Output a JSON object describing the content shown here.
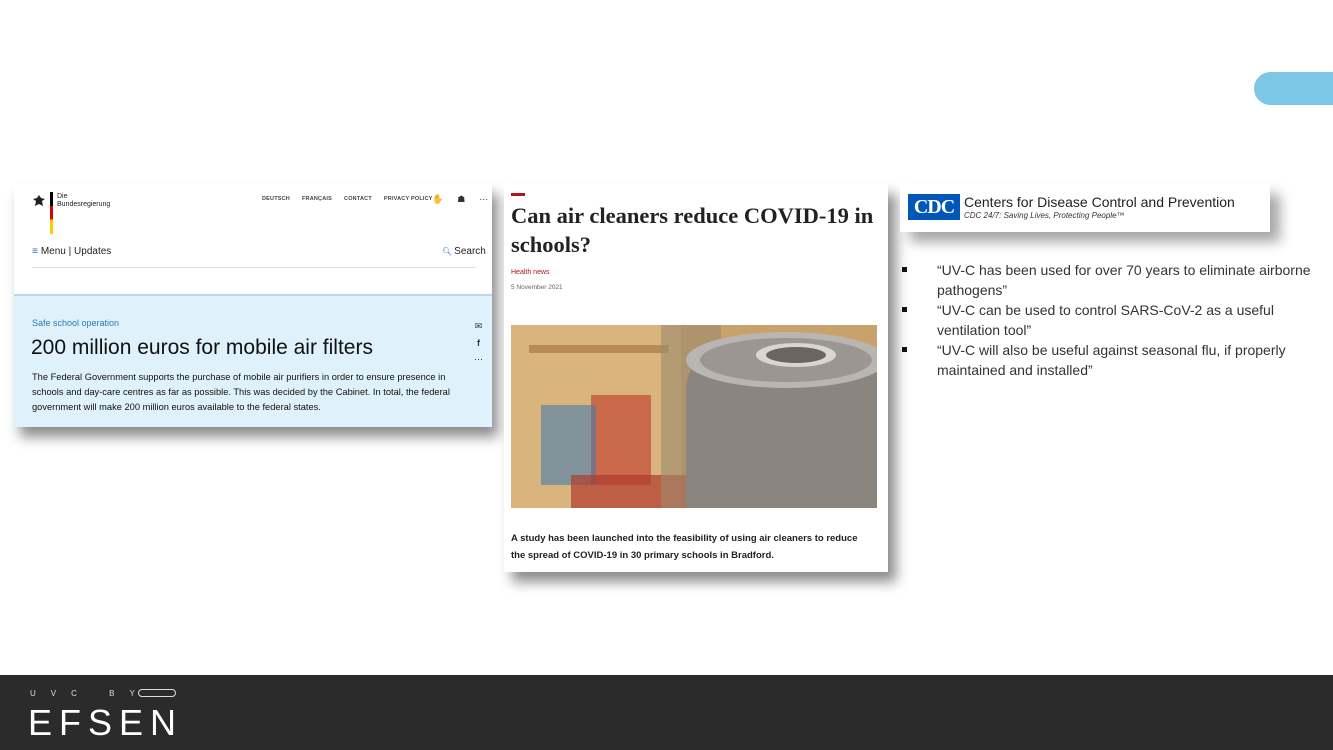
{
  "card_bund": {
    "brand": "Die Bundesregierung",
    "nav": [
      "DEUTSCH",
      "FRANÇAIS",
      "CONTACT",
      "PRIVACY POLICY"
    ],
    "menu_label": "Menu",
    "updates_label": "Updates",
    "search_label": "Search",
    "kicker": "Safe school operation",
    "headline": "200 million euros for mobile air filters",
    "body": "The Federal Government supports the purchase of mobile air purifiers in order to ensure presence in schools and day-care centres as far as possible. This was decided by the Cabinet. In total, the federal government will make 200 million euros available to the federal states."
  },
  "card_news": {
    "headline": "Can air cleaners reduce COVID-19 in schools?",
    "category": "Health news",
    "date": "5 November 2021",
    "lede": "A study has been launched into the feasibility of using air cleaners to reduce the spread of COVID-19 in 30 primary schools in Bradford."
  },
  "card_cdc": {
    "logo_text": "CDC",
    "name": "Centers for Disease Control and Prevention",
    "tagline": "CDC 24/7: Saving Lives, Protecting People™"
  },
  "bullets": [
    "“UV-C has been used for over 70 years to eliminate airborne pathogens”",
    "“UV-C can be used to control SARS-CoV-2 as a useful ventilation tool”",
    "“UV-C will also be useful against seasonal flu, if properly maintained and installed”"
  ],
  "footer": {
    "small": "UVC BY",
    "brand": "EFSEN"
  },
  "colors": {
    "accent_pill": "#7cc7e6",
    "footer_bg": "#2b2b2b",
    "cdc_blue": "#0057b8",
    "bund_panel": "#dff1fa"
  }
}
